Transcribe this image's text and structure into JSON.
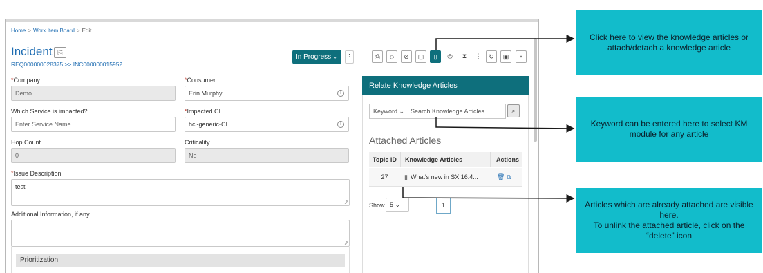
{
  "breadcrumb": {
    "home": "Home",
    "board": "Work Item Board",
    "current": "Edit",
    "sep": ">"
  },
  "header": {
    "title": "Incident",
    "title_icon_glyph": "⎘",
    "ref": "REQ000000028375 >> INC000000015952",
    "status": "In Progress",
    "status_chevron": "⌄",
    "kebab": "⋮"
  },
  "toolbar": {
    "icons": [
      {
        "name": "print-icon",
        "glyph": "⎙"
      },
      {
        "name": "tag-icon",
        "glyph": "◇"
      },
      {
        "name": "attachment-icon",
        "glyph": "⊘"
      },
      {
        "name": "clipboard-icon",
        "glyph": "▢"
      },
      {
        "name": "knowledge-book-icon",
        "glyph": "▯"
      },
      {
        "name": "watch-icon",
        "glyph": "◎"
      },
      {
        "name": "hourglass-icon",
        "glyph": "⧗"
      },
      {
        "name": "more-icon",
        "glyph": "⋮"
      },
      {
        "name": "refresh-icon",
        "glyph": "↻"
      },
      {
        "name": "save-icon",
        "glyph": "▣"
      },
      {
        "name": "close-icon",
        "glyph": "×"
      }
    ]
  },
  "form": {
    "company_label": "Company",
    "company_value": "Demo",
    "consumer_label": "Consumer",
    "consumer_value": "Erin Murphy",
    "service_label": "Which Service is impacted?",
    "service_placeholder": "Enter Service Name",
    "ci_label": "Impacted CI",
    "ci_value": "hcl-generic-CI",
    "hop_label": "Hop Count",
    "hop_value": "0",
    "criticality_label": "Criticality",
    "criticality_value": "No",
    "issue_label": "Issue Description",
    "issue_value": "test",
    "additional_label": "Additional Information, if any",
    "additional_value": "",
    "prioritization_label": "Prioritization",
    "required_mark": "*",
    "info_glyph": "i",
    "resize_glyph": "⁄⁄"
  },
  "panel": {
    "title": "Relate Knowledge Articles",
    "keyword_select": "Keyword",
    "keyword_chevron": "⌄",
    "search_placeholder": "Search Knowledge Articles",
    "search_glyph": "⌕",
    "attached_title": "Attached Articles",
    "table": {
      "headers": [
        "Topic ID",
        "Knowledge Articles",
        "Actions"
      ],
      "rows": [
        {
          "topic_id": "27",
          "doc_glyph": "▮",
          "article": "What's new in SX 16.4...",
          "delete_glyph": "🗑",
          "open_glyph": "⧉"
        }
      ]
    },
    "show_label": "Show",
    "show_value": "5",
    "show_chevron": "⌄",
    "page": "1"
  },
  "callouts": {
    "one": "Click here to view the knowledge articles or attach/detach a knowledge article",
    "two": "Keyword can be entered here to select KM module for any article",
    "three_line1": "Articles which are already attached are visible here.",
    "three_line2": "To unlink the attached article, click on the “delete” icon"
  },
  "colors": {
    "teal": "#0e6f7c",
    "callout": "#12bccb",
    "link": "#1f6db2",
    "required": "#c0392b"
  }
}
